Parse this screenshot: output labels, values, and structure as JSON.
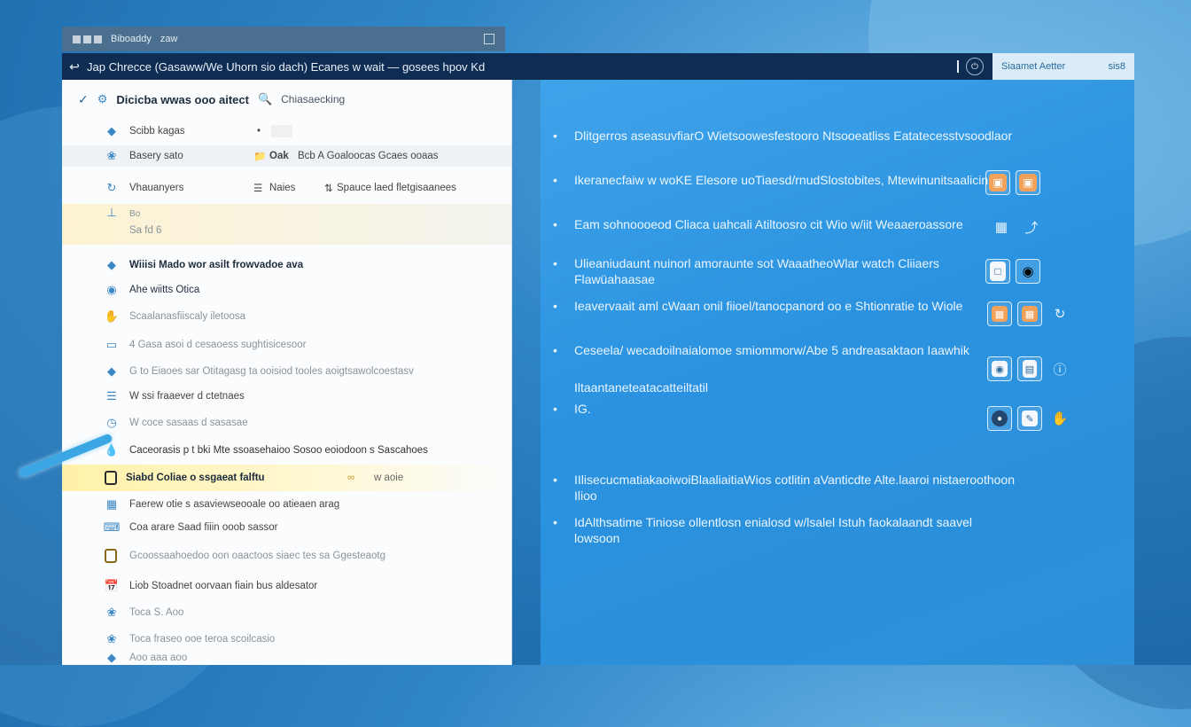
{
  "back_window": {
    "title_a": "Biboaddy",
    "title_b": "zaw"
  },
  "titlebar": {
    "back_icon": "back-arrow-icon",
    "title": "Jap Chrecce (Gasaww/We Uhorn sio dach) Ecanes w wait — gosees hpov Kd",
    "right_label": "Siaamet Aetter",
    "right_value": "sis8"
  },
  "left_panel": {
    "header": {
      "title": "Dicicba wwas ooo aitect",
      "tag": "Chiasaecking"
    },
    "rows": [
      {
        "label": "Scibb kagas",
        "col2": "•",
        "col3": ""
      },
      {
        "label": "Basery sato",
        "col2": "Oak",
        "col3": "Bcb A Goaloocas Gcaes ooaas"
      },
      {
        "label": "Vhauanyers",
        "col2": "Naies",
        "col3": "Spauce laed fletgisaanees"
      },
      {
        "label": "Bo",
        "label2": "Sa fd 6"
      },
      {
        "label": "Wiiisi Mado wor asilt frowvadoe ava"
      },
      {
        "label": "Ahe wiitts Otica"
      },
      {
        "label": "Scaalanasfiiscaly iletoosa"
      },
      {
        "label": "4 Gasa asoi d cesaoess sughtisicesoor"
      },
      {
        "label": "G to Eiaoes sar Otitagasg ta ooisiod tooles aoigtsawolcoestasv"
      },
      {
        "label": "W ssi fraaever d ctetnaes"
      },
      {
        "label": "W coce sasaas d sasasae"
      },
      {
        "label": "Caceorasis p t bki Mte ssoasehaioo Sosoo eoiodoon s Sascahoes"
      },
      {
        "label": "Siabd Coliae o ssgaeat falftu",
        "tail": "w aoie"
      },
      {
        "label": "Faerew otie s asaviewseooale oo atieaen arag"
      },
      {
        "label": "Coa arare Saad fiiin ooob sassor"
      },
      {
        "label": "Gcoossaahoedoo oon oaactoos siaec tes sa Ggesteaotg"
      },
      {
        "label": "Liob Stoadnet oorvaan fiain bus aldesator"
      },
      {
        "label": "Toca S. Aoo"
      },
      {
        "label": "Toca fraseo ooe teroa scoilcasio"
      },
      {
        "label": "Aoo aaa aoo"
      }
    ]
  },
  "right_panel": {
    "items": [
      {
        "text": "Dlitgerros aseasuvfiarO Wietsoowesfestooro Ntsooeatliss Eatatecesstvsoodlaor"
      },
      {
        "text": "Ikeranecfaiw w woKE Elesore uoTiaesd/rnudSlostobites, Mtewinunitsaalicin"
      },
      {
        "text": "Eam sohnoooeod Cliaca uahcali Atiltoosro cit Wio w/iit Weaaeroassore"
      },
      {
        "text": "Ulieaniudaunt nuinorl amoraunte sot WaaatheoWlar watch Cliiaers Flawüahaasae"
      },
      {
        "text": "Ieavervaait aml cWaan onil fiioel/tanocpanord oo e Shtionratie to Wiole"
      },
      {
        "text": "Ceseela/ wecadoilnaialomoe smiommorw/Abe 5 andreasaktaon Iaawhik"
      },
      {
        "text": "Iltaantaneteatacatteiltatil"
      },
      {
        "text": "IG."
      },
      {
        "text": "IIlisecucmatiakaoiwoiBlaaliaitiaWios cotlitin aVanticdte Alte.laaroi nistaeroothoon Ilioo"
      },
      {
        "text": "IdAlthsatime Tiniose ollentlosn enialosd w/lsalel Istuh faokalaandt saavel lowsoon"
      }
    ],
    "icons": [
      [
        "app-orange-icon",
        "app-orange-icon"
      ],
      [
        "grid-icon",
        "link-icon"
      ],
      [
        "document-icon",
        "globe-icon"
      ],
      [
        "calendar-icon",
        "calendar-icon",
        "refresh-icon"
      ],
      [
        "camera-icon",
        "file-icon",
        "info-icon"
      ],
      [
        "circle-icon",
        "edit-icon",
        "hand-icon"
      ]
    ]
  }
}
